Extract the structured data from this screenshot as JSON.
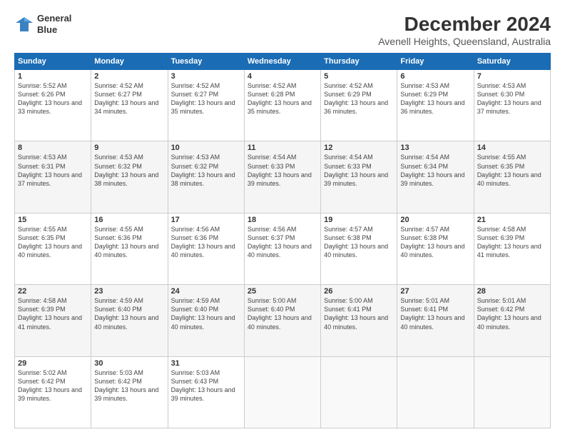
{
  "header": {
    "logo_line1": "General",
    "logo_line2": "Blue",
    "month": "December 2024",
    "location": "Avenell Heights, Queensland, Australia"
  },
  "weekdays": [
    "Sunday",
    "Monday",
    "Tuesday",
    "Wednesday",
    "Thursday",
    "Friday",
    "Saturday"
  ],
  "weeks": [
    [
      {
        "day": "1",
        "sunrise": "5:52 AM",
        "sunset": "6:26 PM",
        "daylight": "13 hours and 33 minutes."
      },
      {
        "day": "2",
        "sunrise": "4:52 AM",
        "sunset": "6:27 PM",
        "daylight": "13 hours and 34 minutes."
      },
      {
        "day": "3",
        "sunrise": "4:52 AM",
        "sunset": "6:27 PM",
        "daylight": "13 hours and 35 minutes."
      },
      {
        "day": "4",
        "sunrise": "4:52 AM",
        "sunset": "6:28 PM",
        "daylight": "13 hours and 35 minutes."
      },
      {
        "day": "5",
        "sunrise": "4:52 AM",
        "sunset": "6:29 PM",
        "daylight": "13 hours and 36 minutes."
      },
      {
        "day": "6",
        "sunrise": "4:53 AM",
        "sunset": "6:29 PM",
        "daylight": "13 hours and 36 minutes."
      },
      {
        "day": "7",
        "sunrise": "4:53 AM",
        "sunset": "6:30 PM",
        "daylight": "13 hours and 37 minutes."
      }
    ],
    [
      {
        "day": "8",
        "sunrise": "4:53 AM",
        "sunset": "6:31 PM",
        "daylight": "13 hours and 37 minutes."
      },
      {
        "day": "9",
        "sunrise": "4:53 AM",
        "sunset": "6:32 PM",
        "daylight": "13 hours and 38 minutes."
      },
      {
        "day": "10",
        "sunrise": "4:53 AM",
        "sunset": "6:32 PM",
        "daylight": "13 hours and 38 minutes."
      },
      {
        "day": "11",
        "sunrise": "4:54 AM",
        "sunset": "6:33 PM",
        "daylight": "13 hours and 39 minutes."
      },
      {
        "day": "12",
        "sunrise": "4:54 AM",
        "sunset": "6:33 PM",
        "daylight": "13 hours and 39 minutes."
      },
      {
        "day": "13",
        "sunrise": "4:54 AM",
        "sunset": "6:34 PM",
        "daylight": "13 hours and 39 minutes."
      },
      {
        "day": "14",
        "sunrise": "4:55 AM",
        "sunset": "6:35 PM",
        "daylight": "13 hours and 40 minutes."
      }
    ],
    [
      {
        "day": "15",
        "sunrise": "4:55 AM",
        "sunset": "6:35 PM",
        "daylight": "13 hours and 40 minutes."
      },
      {
        "day": "16",
        "sunrise": "4:55 AM",
        "sunset": "6:36 PM",
        "daylight": "13 hours and 40 minutes."
      },
      {
        "day": "17",
        "sunrise": "4:56 AM",
        "sunset": "6:36 PM",
        "daylight": "13 hours and 40 minutes."
      },
      {
        "day": "18",
        "sunrise": "4:56 AM",
        "sunset": "6:37 PM",
        "daylight": "13 hours and 40 minutes."
      },
      {
        "day": "19",
        "sunrise": "4:57 AM",
        "sunset": "6:38 PM",
        "daylight": "13 hours and 40 minutes."
      },
      {
        "day": "20",
        "sunrise": "4:57 AM",
        "sunset": "6:38 PM",
        "daylight": "13 hours and 40 minutes."
      },
      {
        "day": "21",
        "sunrise": "4:58 AM",
        "sunset": "6:39 PM",
        "daylight": "13 hours and 41 minutes."
      }
    ],
    [
      {
        "day": "22",
        "sunrise": "4:58 AM",
        "sunset": "6:39 PM",
        "daylight": "13 hours and 41 minutes."
      },
      {
        "day": "23",
        "sunrise": "4:59 AM",
        "sunset": "6:40 PM",
        "daylight": "13 hours and 40 minutes."
      },
      {
        "day": "24",
        "sunrise": "4:59 AM",
        "sunset": "6:40 PM",
        "daylight": "13 hours and 40 minutes."
      },
      {
        "day": "25",
        "sunrise": "5:00 AM",
        "sunset": "6:40 PM",
        "daylight": "13 hours and 40 minutes."
      },
      {
        "day": "26",
        "sunrise": "5:00 AM",
        "sunset": "6:41 PM",
        "daylight": "13 hours and 40 minutes."
      },
      {
        "day": "27",
        "sunrise": "5:01 AM",
        "sunset": "6:41 PM",
        "daylight": "13 hours and 40 minutes."
      },
      {
        "day": "28",
        "sunrise": "5:01 AM",
        "sunset": "6:42 PM",
        "daylight": "13 hours and 40 minutes."
      }
    ],
    [
      {
        "day": "29",
        "sunrise": "5:02 AM",
        "sunset": "6:42 PM",
        "daylight": "13 hours and 39 minutes."
      },
      {
        "day": "30",
        "sunrise": "5:03 AM",
        "sunset": "6:42 PM",
        "daylight": "13 hours and 39 minutes."
      },
      {
        "day": "31",
        "sunrise": "5:03 AM",
        "sunset": "6:43 PM",
        "daylight": "13 hours and 39 minutes."
      },
      null,
      null,
      null,
      null
    ]
  ]
}
